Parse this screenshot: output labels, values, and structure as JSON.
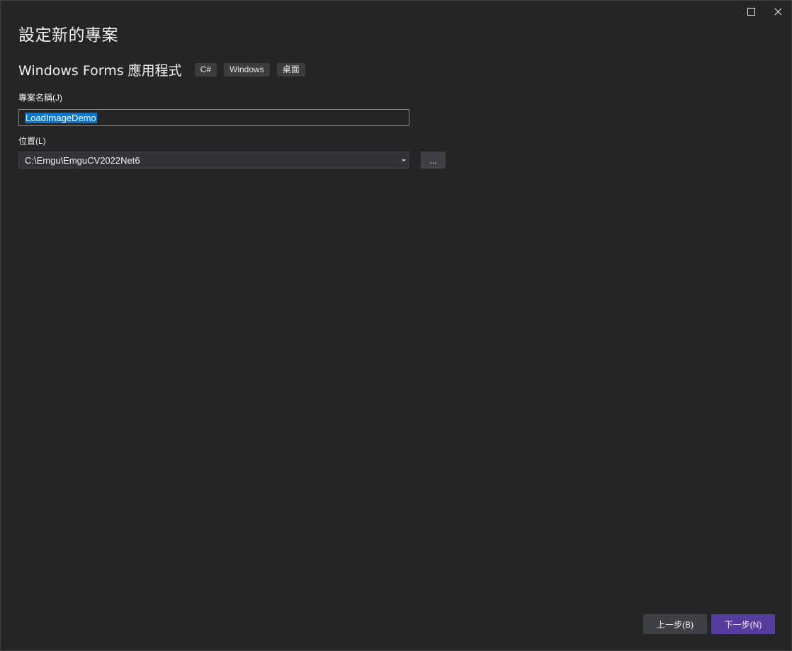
{
  "dialog": {
    "title": "設定新的專案"
  },
  "template": {
    "name": "Windows Forms 應用程式",
    "tags": [
      "C#",
      "Windows",
      "桌面"
    ]
  },
  "project_name": {
    "label": "專案名稱(J)",
    "value": "LoadImageDemo"
  },
  "location": {
    "label": "位置(L)",
    "value": "C:\\Emgu\\EmguCV2022Net6",
    "browse_label": "..."
  },
  "footer": {
    "back_label": "上一步(B)",
    "next_label": "下一步(N)"
  },
  "colors": {
    "background": "#252526",
    "accent": "#573c9f",
    "selection": "#0078d7"
  },
  "icons": {
    "maximize": "maximize-icon",
    "close": "close-icon",
    "dropdown": "chevron-down-icon"
  }
}
